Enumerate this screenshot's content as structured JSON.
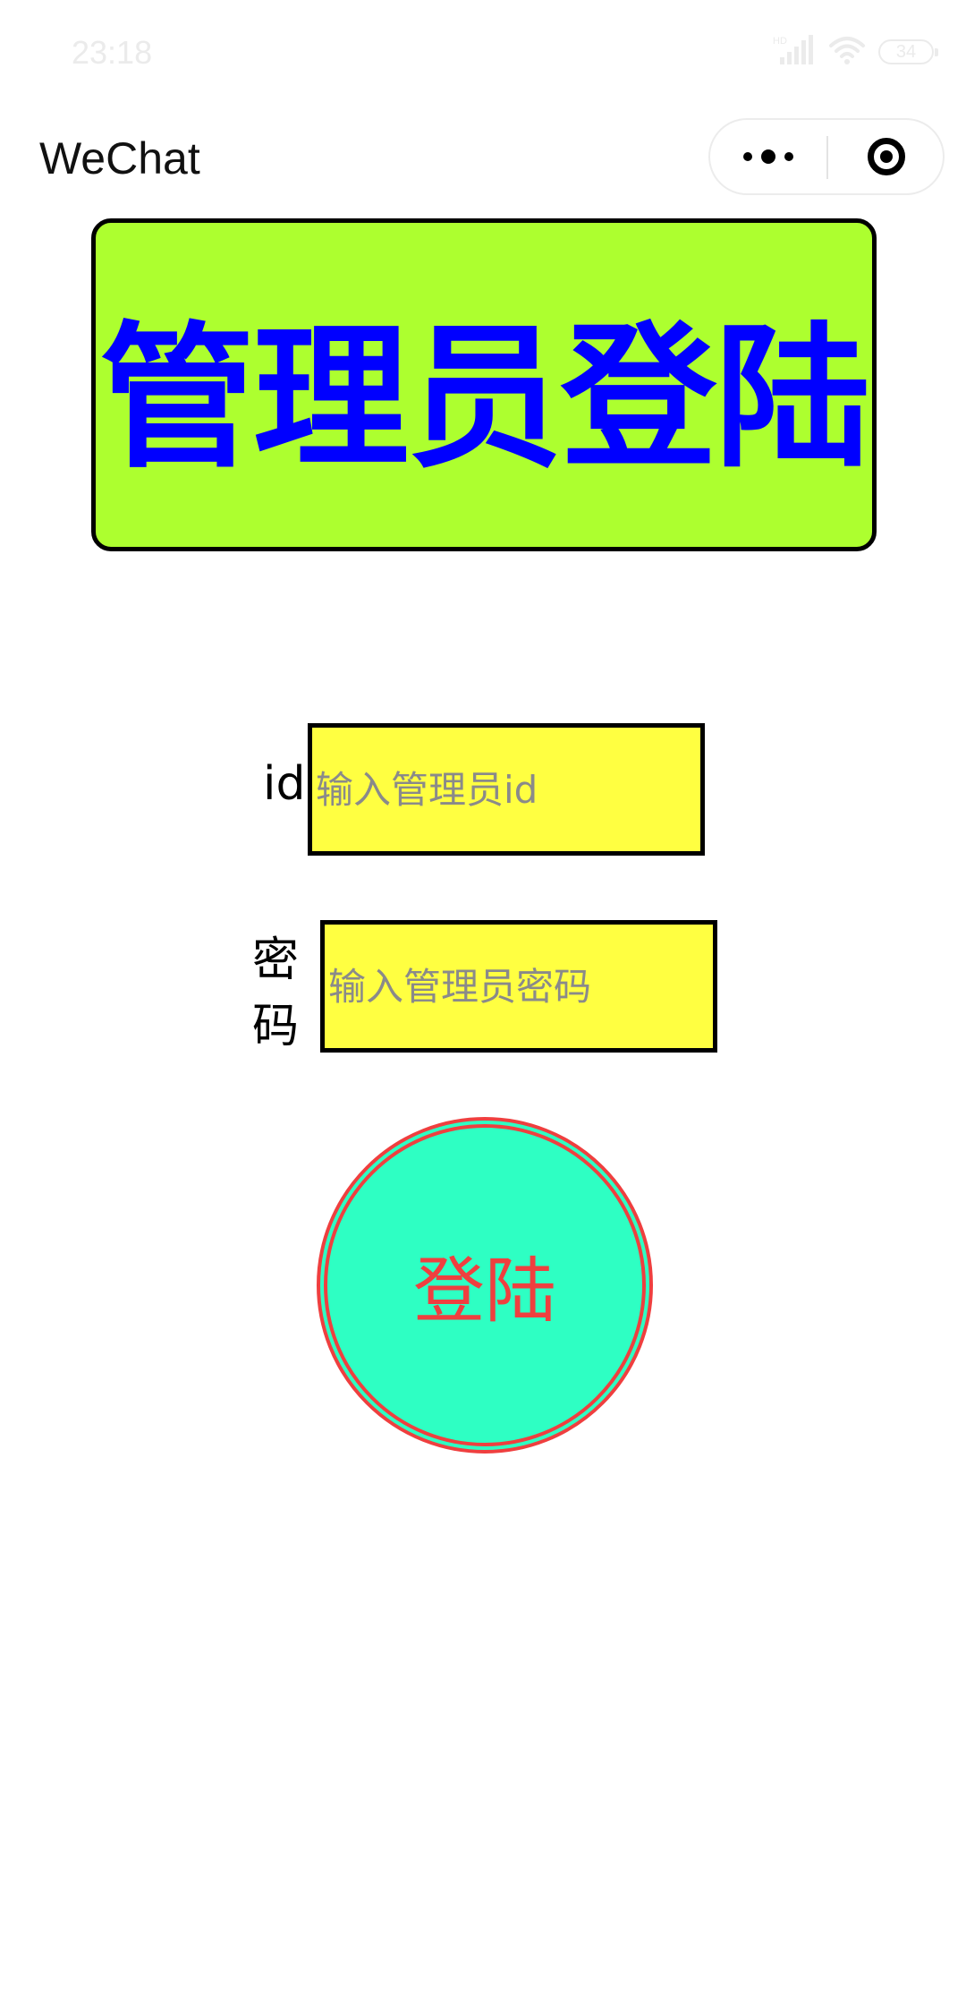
{
  "status_bar": {
    "time": "23:18",
    "network_badge": "HD",
    "battery_level": "34"
  },
  "nav": {
    "title": "WeChat"
  },
  "banner": {
    "title": "管理员登陆"
  },
  "form": {
    "id_label": "id",
    "id_placeholder": "输入管理员id",
    "id_value": "",
    "password_label": "密码",
    "password_placeholder": "输入管理员密码",
    "password_value": ""
  },
  "login_button": {
    "label": "登陆"
  },
  "colors": {
    "banner_background": "#adff2f",
    "banner_text": "#0000ff",
    "input_background": "#ffff41",
    "login_background": "#2effc3",
    "login_border": "#ef3f3f",
    "login_text": "#ef3f3f"
  },
  "icons": {
    "signal": "signal-icon",
    "wifi": "wifi-icon",
    "battery": "battery-icon",
    "more": "more-dots-icon",
    "close": "target-close-icon"
  }
}
